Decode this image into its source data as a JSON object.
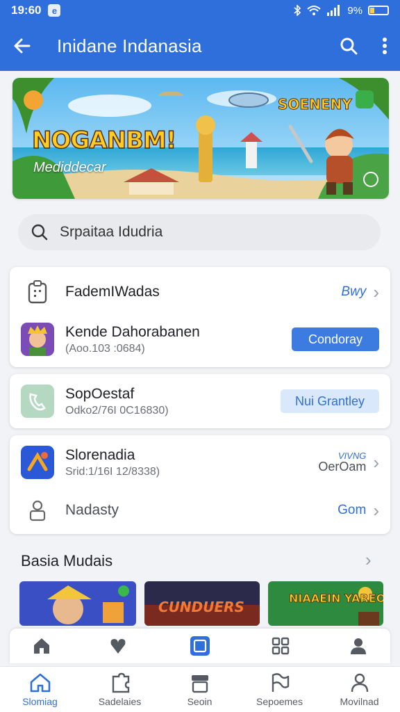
{
  "status": {
    "time": "19:60",
    "app_badge": "e",
    "battery": "9%"
  },
  "appbar": {
    "title": "Inidane Indanasia"
  },
  "banner": {
    "headline": "NOGANBM!",
    "subtitle": "Mediddecar",
    "tagline": "SOENENY"
  },
  "search": {
    "text": "Srpaitaa  Idudria"
  },
  "card1": {
    "row1": {
      "label": "FademIWadas",
      "action": "Bwy"
    },
    "row2": {
      "title": "Kende Dahorabanen",
      "subtitle": "(Aoo.103 :0684)",
      "button": "Condoray"
    }
  },
  "card2": {
    "row1": {
      "title": "SopOestaf",
      "subtitle": "Odko2/76I 0C16830)",
      "button": "Nui Grantley"
    }
  },
  "card3": {
    "row1": {
      "title": "Slorenadia",
      "subtitle": "Srid:1/16I 12/8338)",
      "action_top": "VIVNG",
      "action_bottom": "OerOam"
    },
    "row2": {
      "label": "Nadasty",
      "action": "Gom"
    }
  },
  "section": {
    "title": "Basia Mudais"
  },
  "thumbs": [
    {
      "label": ""
    },
    {
      "label": "CUNDUERS"
    },
    {
      "label": "NIAAEIN YAREO"
    }
  ],
  "nav": {
    "items": [
      {
        "label": "Slomiag",
        "icon": "home-icon"
      },
      {
        "label": "Sadelaies",
        "icon": "puzzle-icon"
      },
      {
        "label": "Seoin",
        "icon": "store-icon"
      },
      {
        "label": "Sepoemes",
        "icon": "flag-icon"
      },
      {
        "label": "Movilnad",
        "icon": "person-icon"
      }
    ]
  },
  "colors": {
    "primary": "#2f6fdc",
    "button": "#3c7ce0",
    "soft_button": "#d9e8fa",
    "battery": "#ffcf3a"
  }
}
